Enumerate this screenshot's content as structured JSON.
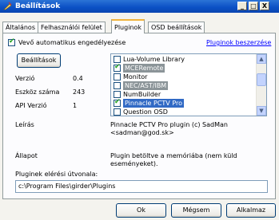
{
  "window": {
    "title": "Beállítások",
    "minimize": "_",
    "maximize": "□",
    "close": "X"
  },
  "tabs": [
    {
      "label": "Általános"
    },
    {
      "label": "Felhasználói felület"
    },
    {
      "label": "Pluginok"
    },
    {
      "label": "OSD beállítások"
    }
  ],
  "plugins": {
    "auto_approve_label": "Vevő automatikus engedélyezése",
    "auto_approve_checked": true,
    "get_plugins_link": "Pluginok beszerzése",
    "settings_button": "Beállítások",
    "version_label": "Verzió",
    "version_value": "0.4",
    "device_count_label": "Eszköz száma",
    "device_count_value": "243",
    "api_version_label": "API Verzió",
    "api_version_value": "1",
    "description_label": "Leírás",
    "description_value_line1": "Pinnacle PCTV Pro plugin (c) SadMan",
    "description_value_line2": "<sadman@god.sk>",
    "state_label": "Állapot",
    "state_value_line1": "Plugin betöltve a memóriába (nem küld",
    "state_value_line2": "eseményeket).",
    "path_label": "Pluginek elérési útvonala:",
    "path_value": "c:\\Program Files\\girder\\Plugins",
    "list": [
      {
        "name": "Lua-Volume Library",
        "checked": false,
        "state": "normal"
      },
      {
        "name": "MCERemote",
        "checked": true,
        "state": "selected"
      },
      {
        "name": "Monitor",
        "checked": false,
        "state": "normal"
      },
      {
        "name": "NEC/AST/IBM",
        "checked": false,
        "state": "selected"
      },
      {
        "name": "NumBuilder",
        "checked": false,
        "state": "normal"
      },
      {
        "name": "Pinnacle PCTV Pro",
        "checked": true,
        "state": "active"
      },
      {
        "name": "Question OSD",
        "checked": false,
        "state": "normal"
      }
    ]
  },
  "buttons": {
    "ok": "Ok",
    "cancel": "Mégsem",
    "apply": "Alkalmaz"
  },
  "colors": {
    "titlebar": "#0a4fc4",
    "selection": "#316ac5",
    "link": "#0000ff",
    "check": "#21a121"
  }
}
